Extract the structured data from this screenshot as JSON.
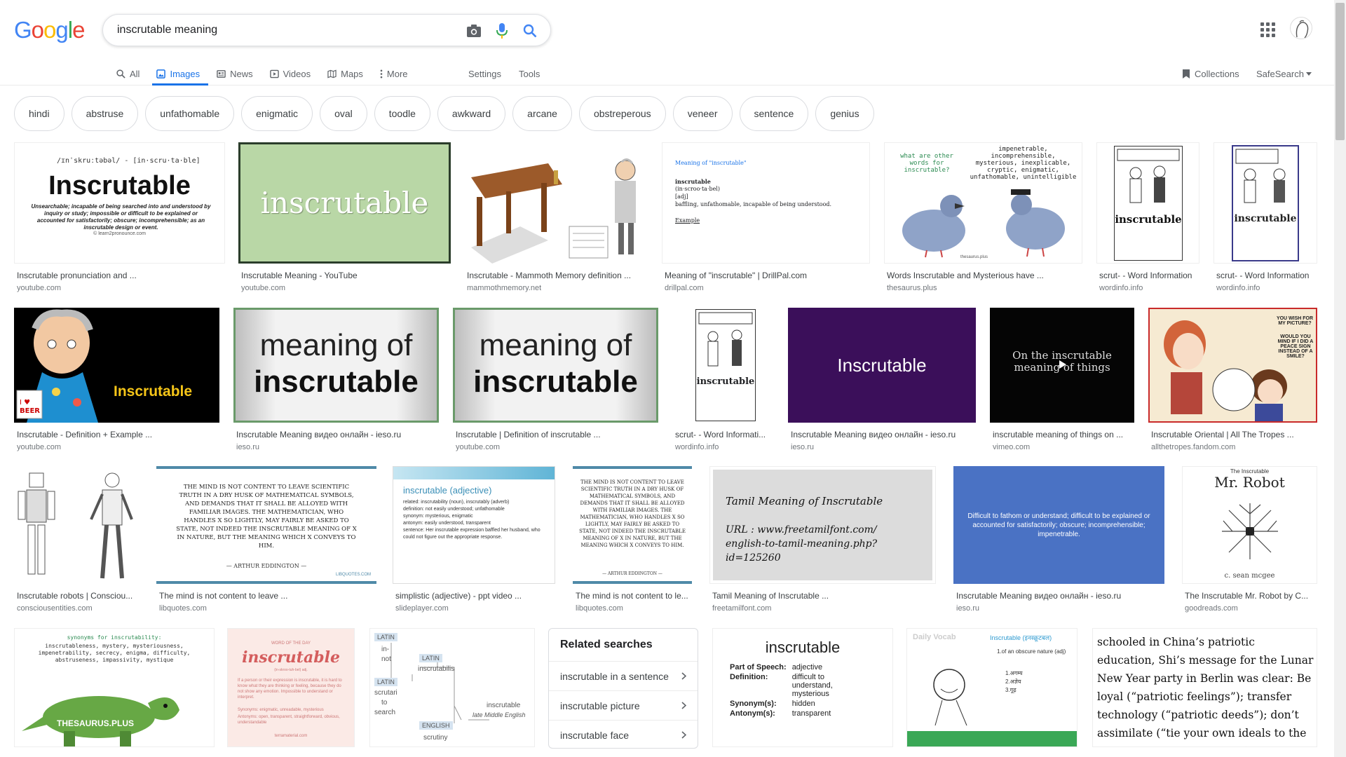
{
  "logo": {
    "letters": [
      "G",
      "o",
      "o",
      "g",
      "l",
      "e"
    ],
    "colors": [
      "#4285f4",
      "#ea4335",
      "#fbbc05",
      "#4285f4",
      "#34a853",
      "#ea4335"
    ]
  },
  "search": {
    "query": "inscrutable meaning"
  },
  "tabs": [
    {
      "label": "All",
      "icon": "search-icon"
    },
    {
      "label": "Images",
      "icon": "image-icon",
      "active": true
    },
    {
      "label": "News",
      "icon": "news-icon"
    },
    {
      "label": "Videos",
      "icon": "video-icon"
    },
    {
      "label": "Maps",
      "icon": "map-icon"
    },
    {
      "label": "More",
      "icon": "more-vert-icon"
    }
  ],
  "tools": {
    "settings": "Settings",
    "tools": "Tools"
  },
  "collections": "Collections",
  "safesearch": "SafeSearch",
  "chips": [
    "hindi",
    "abstruse",
    "unfathomable",
    "enigmatic",
    "oval",
    "toodle",
    "awkward",
    "arcane",
    "obstreperous",
    "veneer",
    "sentence",
    "genius"
  ],
  "results": {
    "row1": [
      {
        "caption": "Inscrutable pronunciation and ...",
        "source": "youtube.com",
        "thumb_text": "Inscrutable",
        "phonetic": "/ɪnˈskruːtəbəl/ - [in·scru·ta·ble]",
        "definition": "Unsearchable; incapable of being searched into and understood by inquiry or study; impossible or difficult to be explained or accounted for satisfactorily; obscure; incomprehensible; as an inscrutable design or event.",
        "credit": "© learn2pronounce.com"
      },
      {
        "caption": "Inscrutable Meaning - YouTube",
        "source": "youtube.com",
        "thumb_text": "inscrutable"
      },
      {
        "caption": "Inscrutable - Mammoth Memory definition ...",
        "source": "mammothmemory.net"
      },
      {
        "caption": "Meaning of \"inscrutable\" | DrillPal.com",
        "source": "drillpal.com",
        "heading": "Meaning of \"inscrutable\"",
        "word": "inscrutable",
        "pron": "(in·scroo·ta·bel)",
        "pos": "[adj]",
        "def": "baffling, unfathomable, incapable of being understood.",
        "example": "Example"
      },
      {
        "caption": "Words Inscrutable and Mysterious have ...",
        "source": "thesaurus.plus",
        "question": "what are other words for inscrutable?",
        "answer": "impenetrable, incomprehensible, mysterious, inexplicable, cryptic, enigmatic, unfathomable, unintelligible",
        "credit": "thesaurus.plus"
      },
      {
        "caption": "scrut- - Word Information",
        "source": "wordinfo.info",
        "word": "inscrutable"
      },
      {
        "caption": "scrut- - Word Information",
        "source": "wordinfo.info",
        "word": "inscrutable"
      }
    ],
    "row2": [
      {
        "caption": "Inscrutable - Definition + Example ...",
        "source": "youtube.com",
        "thumb_text": "Inscrutable",
        "mug": "I ♥ BEER"
      },
      {
        "caption": "Inscrutable Meaning видео онлайн - ieso.ru",
        "source": "ieso.ru",
        "line1": "meaning of",
        "line2": "inscrutable"
      },
      {
        "caption": "Inscrutable | Definition of inscrutable ...",
        "source": "youtube.com",
        "line1": "meaning of",
        "line2": "inscrutable"
      },
      {
        "caption": "scrut- - Word Informati...",
        "source": "wordinfo.info",
        "word": "inscrutable"
      },
      {
        "caption": "Inscrutable Meaning видео онлайн - ieso.ru",
        "source": "ieso.ru",
        "thumb_text": "Inscrutable"
      },
      {
        "caption": "inscrutable meaning of things on ...",
        "source": "vimeo.com",
        "thumb_text": "On the inscrutable meaning of things"
      },
      {
        "caption": "Inscrutable Oriental | All The Tropes ...",
        "source": "allthetropes.fandom.com",
        "bubble1": "YOU WISH FOR MY PICTURE?",
        "bubble2": "WOULD YOU MIND IF I DID A PEACE SIGN INSTEAD OF A SMILE?"
      }
    ],
    "row3": [
      {
        "caption": "Inscrutable robots | Consciou...",
        "source": "consciousentities.com"
      },
      {
        "caption": "The mind is not content to leave ...",
        "source": "libquotes.com",
        "quote": "THE MIND IS NOT CONTENT TO LEAVE SCIENTIFIC TRUTH IN A DRY HUSK OF MATHEMATICAL SYMBOLS, AND DEMANDS THAT IT SHALL BE ALLOYED WITH FAMILIAR IMAGES. THE MATHEMATICIAN, WHO HANDLES X SO LIGHTLY, MAY FAIRLY BE ASKED TO STATE, NOT INDEED THE INSCRUTABLE MEANING OF X IN NATURE, BUT THE MEANING WHICH X CONVEYS TO HIM.",
        "author": "— ARTHUR EDDINGTON —",
        "credit": "LIBQUOTES.COM"
      },
      {
        "caption": "simplistic (adjective) - ppt video ...",
        "source": "slideplayer.com",
        "heading": "inscrutable (adjective)",
        "bullets": [
          "related: inscrutability (noun), inscrutably (adverb)",
          "definition: not easily understood; unfathomable",
          "synonym: mysterious, enigmatic",
          "antonym: easily understood, transparent",
          "sentence: Her inscrutable expression baffled her husband, who could not figure out the appropriate response."
        ]
      },
      {
        "caption": "The mind is not content to le...",
        "source": "libquotes.com",
        "quote": "THE MIND IS NOT CONTENT TO LEAVE SCIENTIFIC TRUTH IN A DRY HUSK OF MATHEMATICAL SYMBOLS, AND DEMANDS THAT IT SHALL BE ALLOYED WITH FAMILIAR IMAGES. THE MATHEMATICIAN, WHO HANDLES X SO LIGHTLY, MAY FAIRLY BE ASKED TO STATE, NOT INDEED THE INSCRUTABLE MEANING OF X IN NATURE, BUT THE MEANING WHICH X CONVEYS TO HIM.",
        "author": "— ARTHUR EDDINGTON —"
      },
      {
        "caption": "Tamil Meaning of Inscrutable ...",
        "source": "freetamilfont.com",
        "title": "Tamil Meaning of Inscrutable",
        "url": "URL : www.freetamilfont.com/ english-to-tamil-meaning.php?id=125260"
      },
      {
        "caption": "Inscrutable Meaning видео онлайн - ieso.ru",
        "source": "ieso.ru",
        "text": "Difficult to fathom or understand; difficult to be explained or accounted for satisfactorily; obscure; incomprehensible; impenetrable."
      },
      {
        "caption": "The Inscrutable Mr. Robot by C...",
        "source": "goodreads.com",
        "small": "The Inscrutable",
        "title": "Mr. Robot",
        "author": "c. sean mcgee"
      }
    ],
    "row4": {
      "thesaurus": {
        "title": "synonyms for inscrutability:",
        "text": "inscrutableness, mystery, mysteriousness, impenetrability, secrecy, enigma, difficulty, abstruseness, impassivity, mystique",
        "credit": "THESAURUS.PLUS"
      },
      "wotd": {
        "small": "WORD OF THE DAY",
        "word": "inscrutable",
        "pron": "(in-skroo-tuh-bel) adj.",
        "text": "If a person or their expression is inscrutable, it is hard to know what they are thinking or feeling, because they do not show any emotion. Impossible to understand or interpret.",
        "syn": "Synonyms: enigmatic, unreadable, mysterious",
        "ant": "Antonyms: open, transparent, straightforward, obvious, understandable",
        "credit": "terramaterial.com"
      },
      "tree": {
        "latin1": "LATIN",
        "in": "in-",
        "not": "not",
        "latin2": "LATIN",
        "latin3": "LATIN",
        "inscrutabilis": "inscrutabilis",
        "scrutari": "scrutari",
        "to": "to",
        "search": "search",
        "english": "ENGLISH",
        "scrutiny": "scrutiny",
        "inscrutable": "inscrutable",
        "period": "late Middle English"
      },
      "dict": {
        "word": "inscrutable",
        "rows": [
          [
            "Part of Speech:",
            "adjective"
          ],
          [
            "Definition:",
            "difficult to understand, mysterious"
          ],
          [
            "Synonym(s):",
            "hidden"
          ],
          [
            "Antonym(s):",
            "transparent"
          ]
        ]
      },
      "hindi": {
        "daily": "Daily",
        "vocab": "Vocab",
        "title": "Inscrutable (इनस्क्रूटबल)",
        "def": "1.of an obscure nature (adj)",
        "list": [
          "1.अगम्य",
          "2.अज्ञेय",
          "3.गूढ़"
        ]
      },
      "text": "schooled in China’s patriotic education, Shi’s message for the Lunar New Year party in Berlin was clear: Be loyal (“patriotic feelings”); transfer technology (“patriotic deeds”); don’t assimilate (“tie your own ideals to the destiny of the motherland”)."
    }
  },
  "related": {
    "title": "Related searches",
    "items": [
      "inscrutable in a sentence",
      "inscrutable picture",
      "inscrutable face"
    ]
  },
  "colors": {
    "accent": "#1a73e8",
    "chip_border": "#dadce0"
  }
}
